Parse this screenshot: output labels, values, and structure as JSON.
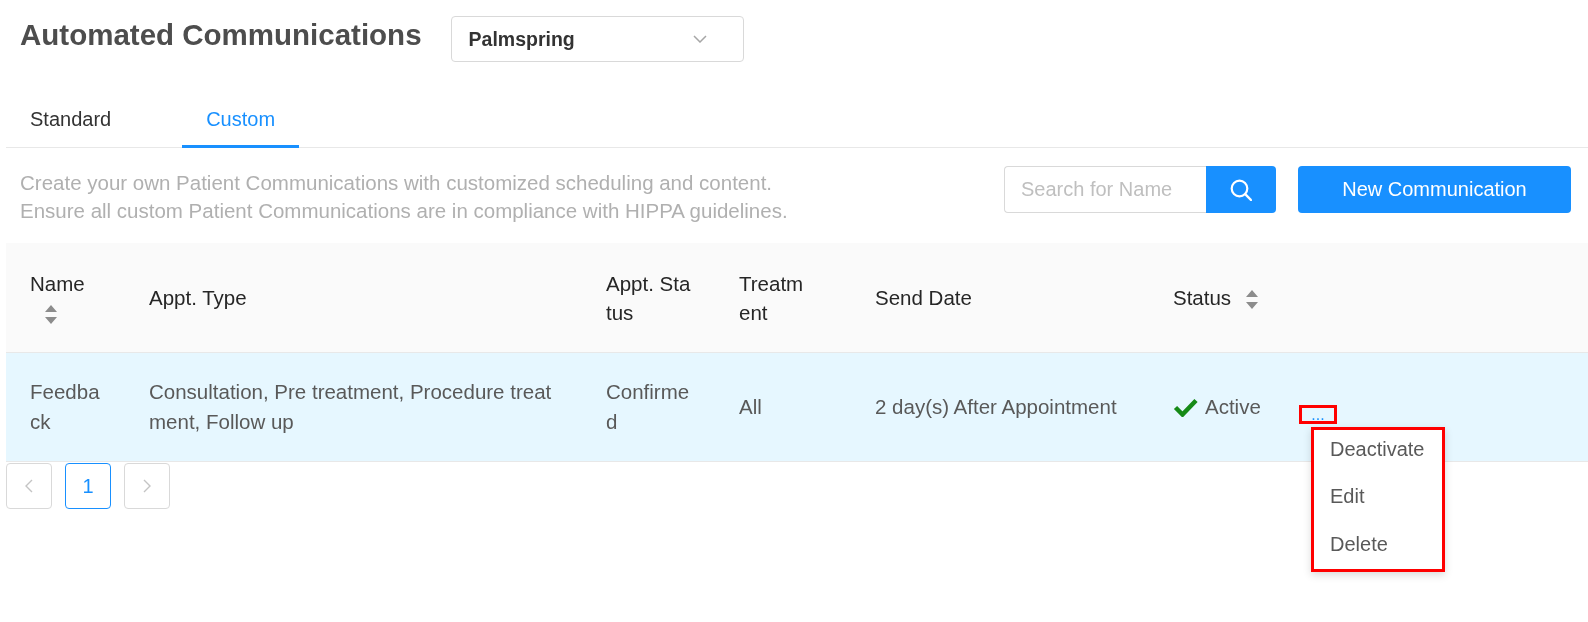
{
  "page": {
    "title": "Automated Communications"
  },
  "location_select": {
    "value": "Palmspring"
  },
  "tabs": [
    {
      "label": "Standard",
      "selected": false
    },
    {
      "label": "Custom",
      "selected": true
    }
  ],
  "description": [
    "Create your own Patient Communications with customized scheduling and content.",
    "Ensure all custom Patient Communications are in compliance with HIPPA guidelines."
  ],
  "search": {
    "placeholder": "Search for Name"
  },
  "new_button": {
    "label": "New Communication"
  },
  "table": {
    "columns": [
      {
        "label": "Name",
        "sortable": true
      },
      {
        "label": "Appt. Type",
        "sortable": false
      },
      {
        "label": "Appt. Status",
        "sortable": false
      },
      {
        "label": "Treatment",
        "sortable": false
      },
      {
        "label": "Send Date",
        "sortable": false
      },
      {
        "label": "Status",
        "sortable": true
      }
    ],
    "rows": [
      {
        "highlighted": true,
        "cells": [
          "Feedback",
          "Consultation, Pre treatment, Procedure treatment, Follow up",
          "Confirmed",
          "All",
          "2 day(s) After Appointment"
        ],
        "status": {
          "kind": "active",
          "label": "Active"
        },
        "more": {
          "label": "...",
          "annotated": true
        },
        "menu": {
          "open": true,
          "annotated": true,
          "items": [
            "Deactivate",
            "Edit",
            "Delete"
          ]
        }
      }
    ]
  },
  "pagination": {
    "prev_disabled": true,
    "pages": [
      {
        "label": "1",
        "selected": true
      }
    ],
    "next_disabled": true
  }
}
